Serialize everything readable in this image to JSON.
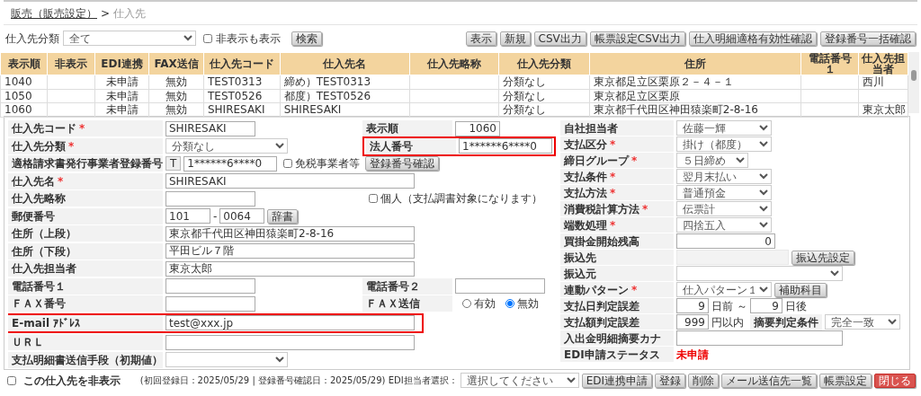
{
  "breadcrumb": {
    "parent": "販売（販売設定）",
    "separator": ">",
    "current": "仕入先"
  },
  "filter": {
    "label": "仕入先分類",
    "value": "全て",
    "show_hidden": {
      "label": "非表示も表示",
      "checked": false
    },
    "search_button": "検索"
  },
  "toolbar": [
    "表示",
    "新規",
    "CSV出力",
    "帳票設定CSV出力",
    "仕入明細適格有効性確認",
    "登録番号一括確認"
  ],
  "table": {
    "columns": [
      "表示順",
      "非表示",
      "EDI連携",
      "FAX送信",
      "仕入先コード",
      "仕入先名",
      "仕入先略称",
      "仕入先分類",
      "住所",
      "電話番号１",
      "仕入先担当者"
    ],
    "rows": [
      [
        "1040",
        null,
        "未申請",
        "無効",
        "TEST0313",
        "締め）TEST0313",
        null,
        "分類なし",
        "東京都足立区栗原２－４－１",
        null,
        "西川"
      ],
      [
        "1050",
        null,
        "未申請",
        "無効",
        "TEST0526",
        "都度）TEST0526",
        null,
        "分類なし",
        "東京都足立区栗原",
        null,
        null
      ],
      [
        "1060",
        null,
        "未申請",
        "無効",
        "SHIRESAKI",
        "SHIRESAKI",
        null,
        "分類なし",
        "東京都千代田区神田猿楽町2-8-16",
        null,
        "東京太郎"
      ]
    ]
  },
  "form_left": [
    {
      "label": "仕入先コード",
      "required_mark": "*",
      "controls": [
        {
          "kind": "input",
          "value": "SHIRESAKI"
        }
      ],
      "side": {
        "label": "表示順",
        "controls": [
          {
            "kind": "number",
            "value": "1060"
          }
        ]
      }
    },
    {
      "label": "仕入先分類",
      "required_mark": "*",
      "controls": [
        {
          "kind": "select",
          "value": "分類なし"
        }
      ],
      "side": {
        "label": "法人番号",
        "highlighted": true,
        "controls": [
          {
            "kind": "input",
            "value": "1******6****0"
          }
        ]
      }
    },
    {
      "label": "適格請求書発行事業者登録番号",
      "controls": [
        {
          "kind": "prefix",
          "text": "T"
        },
        {
          "kind": "input",
          "value": "1******6****0"
        },
        {
          "kind": "checkbox",
          "label": "免税事業者等",
          "checked": false
        }
      ],
      "side": {
        "controls": [
          {
            "kind": "button",
            "label": "登録番号確認"
          }
        ]
      }
    },
    {
      "label": "仕入先名",
      "required_mark": "*",
      "controls": [
        {
          "kind": "input",
          "value": "SHIRESAKI"
        }
      ]
    },
    {
      "label": "仕入先略称",
      "controls": [
        {
          "kind": "input"
        }
      ],
      "side": {
        "controls": [
          {
            "kind": "checkbox",
            "label": "個人（支払調書対象になります）",
            "checked": false
          }
        ]
      }
    },
    {
      "label": "郵便番号",
      "controls": [
        {
          "kind": "input",
          "value": "101"
        },
        {
          "kind": "text",
          "text": "-"
        },
        {
          "kind": "input",
          "value": "0064"
        },
        {
          "kind": "button",
          "label": "辞書"
        }
      ]
    },
    {
      "label": "住所（上段）",
      "controls": [
        {
          "kind": "input",
          "value": "東京都千代田区神田猿楽町2-8-16"
        }
      ]
    },
    {
      "label": "住所（下段）",
      "controls": [
        {
          "kind": "input",
          "value": "平田ビル７階"
        }
      ]
    },
    {
      "label": "仕入先担当者",
      "controls": [
        {
          "kind": "input",
          "value": "東京太郎"
        }
      ]
    },
    {
      "label": "電話番号１",
      "controls": [
        {
          "kind": "input"
        }
      ],
      "side": {
        "label": "電話番号２",
        "controls": [
          {
            "kind": "input"
          }
        ]
      }
    },
    {
      "label": "ＦＡＸ番号",
      "controls": [
        {
          "kind": "input"
        }
      ],
      "side": {
        "label": "ＦＡＸ送信",
        "controls": [
          {
            "kind": "radio",
            "options": [
              {
                "label": "有効",
                "selected": false
              },
              {
                "label": "無効",
                "selected": true
              }
            ]
          }
        ]
      }
    },
    {
      "label": "E-mail ｱﾄﾞﾚｽ",
      "highlighted": true,
      "controls": [
        {
          "kind": "input",
          "value": "test@xxx.jp"
        }
      ]
    },
    {
      "label": "ＵＲＬ",
      "controls": [
        {
          "kind": "input"
        }
      ]
    },
    {
      "label": "支払明細書送信手段（初期値）",
      "controls": [
        {
          "kind": "select"
        }
      ]
    }
  ],
  "form_right": [
    {
      "label": "自社担当者",
      "controls": [
        {
          "kind": "select",
          "value": "佐藤一輝"
        }
      ]
    },
    {
      "label": "支払区分",
      "required_mark": "*",
      "controls": [
        {
          "kind": "select",
          "value": "掛け（都度）"
        }
      ]
    },
    {
      "label": "締日グループ",
      "required_mark": "*",
      "controls": [
        {
          "kind": "select",
          "value": "５日締め"
        }
      ]
    },
    {
      "label": "支払条件",
      "required_mark": "*",
      "controls": [
        {
          "kind": "select",
          "value": "翌月末払い"
        }
      ]
    },
    {
      "label": "支払方法",
      "required_mark": "*",
      "controls": [
        {
          "kind": "select",
          "value": "普通預金"
        }
      ]
    },
    {
      "label": "消費税計算方法",
      "required_mark": "*",
      "controls": [
        {
          "kind": "select",
          "value": "伝票計"
        }
      ]
    },
    {
      "label": "端数処理",
      "required_mark": "*",
      "controls": [
        {
          "kind": "select",
          "value": "四捨五入"
        }
      ]
    },
    {
      "label": "買掛金開始残高",
      "controls": [
        {
          "kind": "number",
          "value": "0"
        }
      ]
    },
    {
      "label": "振込先",
      "controls": [
        {
          "kind": "input",
          "disabled": true
        },
        {
          "kind": "button",
          "label": "振込先設定"
        }
      ]
    },
    {
      "label": "振込元",
      "controls": [
        {
          "kind": "select"
        }
      ]
    },
    {
      "label": "連動パターン",
      "required_mark": "*",
      "controls": [
        {
          "kind": "select",
          "value": "仕入パターン１"
        },
        {
          "kind": "button",
          "label": "補助科目"
        }
      ]
    },
    {
      "label": "支払日判定誤差",
      "controls": [
        {
          "kind": "number",
          "value": "9"
        },
        {
          "kind": "text",
          "text": "日前 ～"
        },
        {
          "kind": "number",
          "value": "9"
        },
        {
          "kind": "text",
          "text": "日後"
        }
      ]
    },
    {
      "label": "支払額判定誤差",
      "controls": [
        {
          "kind": "number",
          "value": "999"
        },
        {
          "kind": "text",
          "text": "円以内"
        },
        {
          "kind": "sublabel",
          "text": "摘要判定条件"
        },
        {
          "kind": "select",
          "value": "完全一致"
        }
      ]
    },
    {
      "label": "入出金明細摘要カナ",
      "controls": [
        {
          "kind": "input"
        }
      ]
    },
    {
      "label": "EDI申請ステータス",
      "controls": [
        {
          "kind": "status",
          "text": "未申請"
        }
      ]
    }
  ],
  "footer": {
    "hide_checkbox": {
      "label": "この仕入先を非表示",
      "checked": false
    },
    "info": "(初回登録日：2025/05/29 | 登録番号確認日：2025/05/29) EDI担当者選択：",
    "edi_select": "選択してください",
    "buttons": [
      {
        "label": "EDI連携申請",
        "kind": "normal"
      },
      {
        "label": "登録",
        "kind": "normal"
      },
      {
        "label": "削除",
        "kind": "normal"
      },
      {
        "label": "メール送信先一覧",
        "kind": "normal"
      },
      {
        "label": "帳票設定",
        "kind": "normal"
      },
      {
        "label": "閉じる",
        "kind": "danger"
      }
    ]
  }
}
